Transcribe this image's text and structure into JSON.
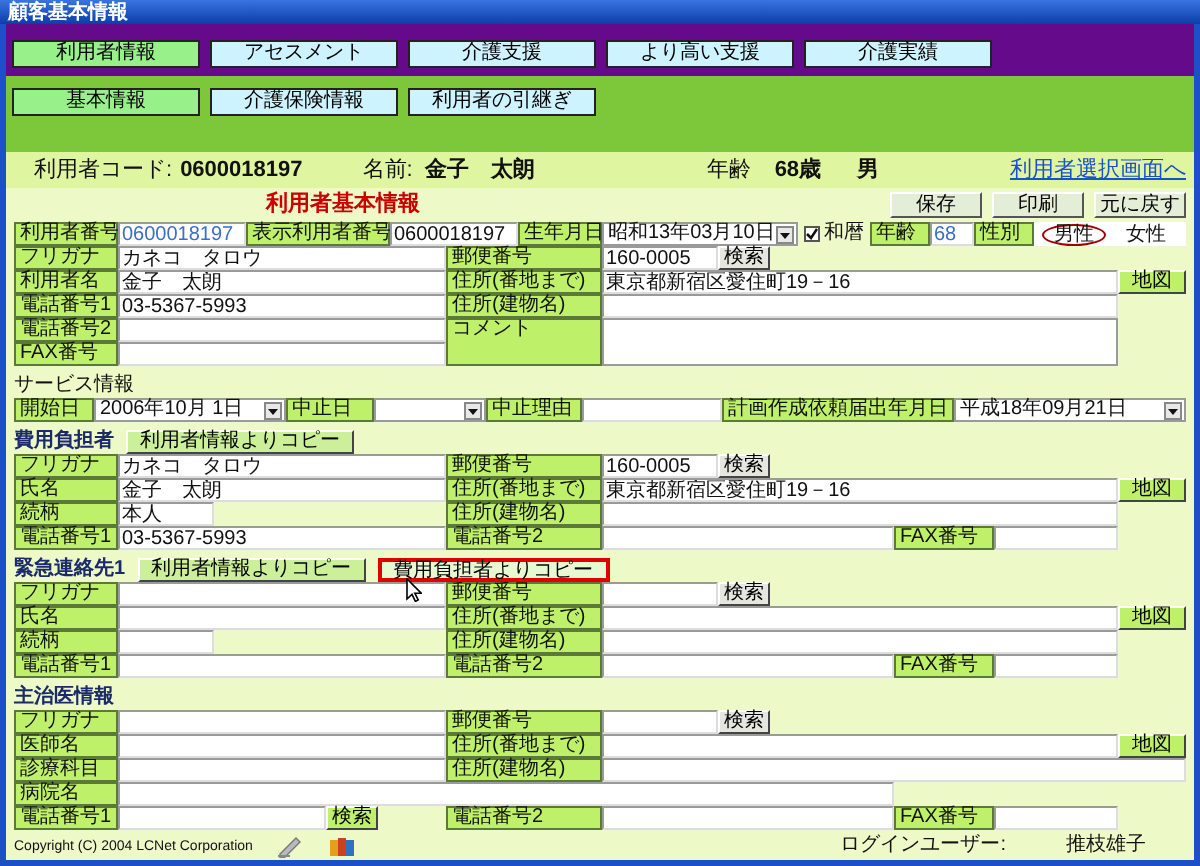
{
  "window": {
    "title": "顧客基本情報"
  },
  "main_tabs": [
    {
      "label": "利用者情報",
      "selected": true
    },
    {
      "label": "アセスメント",
      "selected": false
    },
    {
      "label": "介護支援",
      "selected": false
    },
    {
      "label": "より高い支援",
      "selected": false
    },
    {
      "label": "介護実績",
      "selected": false
    }
  ],
  "sub_tabs": [
    {
      "label": "基本情報",
      "selected": true
    },
    {
      "label": "介護保険情報",
      "selected": false
    },
    {
      "label": "利用者の引継ぎ",
      "selected": false
    }
  ],
  "summary": {
    "code_label": "利用者コード:",
    "code": "0600018197",
    "name_label": "名前:",
    "name": "金子　太朗",
    "age_label": "年齢",
    "age": "68歳",
    "sex": "男",
    "link": "利用者選択画面へ"
  },
  "form": {
    "title": "利用者基本情報",
    "actions": [
      "保存",
      "印刷",
      "元に戻す"
    ],
    "sections": [
      {
        "kind": "user",
        "top_row": [
          {
            "kind": "label",
            "text": "利用者番号"
          },
          {
            "kind": "field",
            "value": "0600018197",
            "readonly": true
          },
          {
            "kind": "label",
            "text": "表示利用者番号"
          },
          {
            "kind": "field",
            "value": "0600018197",
            "readonly": false
          },
          {
            "kind": "label",
            "text": "生年月日"
          },
          {
            "kind": "select",
            "value": "昭和13年03月10日"
          },
          {
            "kind": "check",
            "text": "和暦",
            "checked": true
          },
          {
            "kind": "label",
            "text": "年齢"
          },
          {
            "kind": "field",
            "value": "68",
            "readonly": true
          },
          {
            "kind": "label",
            "text": "性別"
          },
          {
            "kind": "radio",
            "options": [
              {
                "text": "男性",
                "selected": true
              },
              {
                "text": "女性",
                "selected": false
              }
            ]
          }
        ],
        "rows": [
          [
            {
              "kind": "label",
              "text": "フリガナ"
            },
            {
              "kind": "field",
              "value": "カネコ　タロウ",
              "readonly": false
            },
            {
              "kind": "label",
              "text": "郵便番号"
            },
            {
              "kind": "field_button",
              "value": "160-0005",
              "button": {
                "kind": "search",
                "text": "検索"
              }
            }
          ],
          [
            {
              "kind": "label",
              "text": "利用者名"
            },
            {
              "kind": "field",
              "value": "金子　太朗",
              "readonly": false
            },
            {
              "kind": "label",
              "text": "住所(番地まで)"
            },
            {
              "kind": "field",
              "value": "東京都新宿区愛住町19－16",
              "readonly": false
            },
            {
              "kind": "map",
              "text": "地図"
            }
          ],
          [
            {
              "kind": "label",
              "text": "電話番号1"
            },
            {
              "kind": "field",
              "value": "03-5367-5993",
              "readonly": false
            },
            {
              "kind": "label",
              "text": "住所(建物名)"
            },
            {
              "kind": "field"
            }
          ],
          [
            {
              "kind": "label",
              "text": "電話番号2"
            },
            {
              "kind": "field"
            },
            {
              "kind": "label",
              "text": "コメント"
            },
            {
              "kind": "area"
            }
          ],
          [
            {
              "kind": "label",
              "text": "FAX番号"
            },
            {
              "kind": "field"
            }
          ]
        ]
      },
      {
        "kind": "service",
        "heading": "サービス情報",
        "rows": [
          [
            {
              "kind": "label",
              "text": "開始日"
            },
            {
              "kind": "select",
              "value": "2006年10月 1日"
            },
            {
              "kind": "label",
              "text": "中止日"
            },
            {
              "kind": "select"
            },
            {
              "kind": "label",
              "text": "中止理由"
            },
            {
              "kind": "field"
            },
            {
              "kind": "label",
              "text": "計画作成依頼届出年月日"
            },
            {
              "kind": "select",
              "value": "平成18年09月21日"
            }
          ]
        ]
      },
      {
        "kind": "party",
        "heading": "費用負担者",
        "copy_buttons": [
          {
            "label": "利用者情報よりコピー",
            "highlighted": false
          }
        ],
        "rows": [
          [
            {
              "kind": "label",
              "text": "フリガナ"
            },
            {
              "kind": "field",
              "value": "カネコ　タロウ",
              "readonly": false
            },
            {
              "kind": "label",
              "text": "郵便番号"
            },
            {
              "kind": "field_button",
              "value": "160-0005",
              "button": {
                "kind": "search",
                "text": "検索"
              }
            }
          ],
          [
            {
              "kind": "label",
              "text": "氏名"
            },
            {
              "kind": "field",
              "value": "金子　太朗",
              "readonly": false
            },
            {
              "kind": "label",
              "text": "住所(番地まで)"
            },
            {
              "kind": "field",
              "value": "東京都新宿区愛住町19－16",
              "readonly": false
            },
            {
              "kind": "map",
              "text": "地図"
            }
          ],
          [
            {
              "kind": "label",
              "text": "続柄"
            },
            {
              "kind": "field",
              "value": "本人",
              "readonly": false
            },
            {
              "kind": "label",
              "text": "住所(建物名)"
            },
            {
              "kind": "field"
            }
          ],
          [
            {
              "kind": "label",
              "text": "電話番号1"
            },
            {
              "kind": "field",
              "value": "03-5367-5993",
              "readonly": false
            },
            {
              "kind": "label",
              "text": "電話番号2"
            },
            {
              "kind": "field"
            },
            {
              "kind": "label",
              "text": "FAX番号"
            },
            {
              "kind": "field"
            }
          ]
        ]
      },
      {
        "kind": "party",
        "heading": "緊急連絡先1",
        "copy_buttons": [
          {
            "label": "利用者情報よりコピー",
            "highlighted": false
          },
          {
            "label": "費用負担者よりコピー",
            "highlighted": true
          }
        ],
        "rows": [
          [
            {
              "kind": "label",
              "text": "フリガナ"
            },
            {
              "kind": "field"
            },
            {
              "kind": "label",
              "text": "郵便番号"
            },
            {
              "kind": "field_button",
              "button": {
                "kind": "search",
                "text": "検索"
              }
            }
          ],
          [
            {
              "kind": "label",
              "text": "氏名"
            },
            {
              "kind": "field"
            },
            {
              "kind": "label",
              "text": "住所(番地まで)"
            },
            {
              "kind": "field"
            },
            {
              "kind": "map",
              "text": "地図"
            }
          ],
          [
            {
              "kind": "label",
              "text": "続柄"
            },
            {
              "kind": "field"
            },
            {
              "kind": "label",
              "text": "住所(建物名)"
            },
            {
              "kind": "field"
            }
          ],
          [
            {
              "kind": "label",
              "text": "電話番号1"
            },
            {
              "kind": "field"
            },
            {
              "kind": "label",
              "text": "電話番号2"
            },
            {
              "kind": "field"
            },
            {
              "kind": "label",
              "text": "FAX番号"
            },
            {
              "kind": "field"
            }
          ]
        ]
      },
      {
        "kind": "doctor",
        "heading": "主治医情報",
        "rows": [
          [
            {
              "kind": "label",
              "text": "フリガナ"
            },
            {
              "kind": "field"
            },
            {
              "kind": "label",
              "text": "郵便番号"
            },
            {
              "kind": "field_button",
              "button": {
                "kind": "search",
                "text": "検索"
              }
            }
          ],
          [
            {
              "kind": "label",
              "text": "医師名"
            },
            {
              "kind": "field"
            },
            {
              "kind": "label",
              "text": "住所(番地まで)"
            },
            {
              "kind": "field"
            },
            {
              "kind": "map",
              "text": "地図"
            }
          ],
          [
            {
              "kind": "label",
              "text": "診療科目"
            },
            {
              "kind": "field"
            },
            {
              "kind": "label",
              "text": "住所(建物名)"
            },
            {
              "kind": "field"
            }
          ],
          [
            {
              "kind": "label",
              "text": "病院名"
            },
            {
              "kind": "field"
            }
          ],
          [
            {
              "kind": "label",
              "text": "電話番号1"
            },
            {
              "kind": "field_button",
              "button": {
                "kind": "search_alt",
                "text": "検索"
              }
            },
            {
              "kind": "label",
              "text": "電話番号2"
            },
            {
              "kind": "field"
            },
            {
              "kind": "label",
              "text": "FAX番号"
            },
            {
              "kind": "field"
            }
          ]
        ]
      }
    ]
  },
  "footer": {
    "copyright": "Copyright (C) 2004 LCNet Corporation",
    "login_label": "ログインユーザー:",
    "login_user": "推枝雄子"
  }
}
